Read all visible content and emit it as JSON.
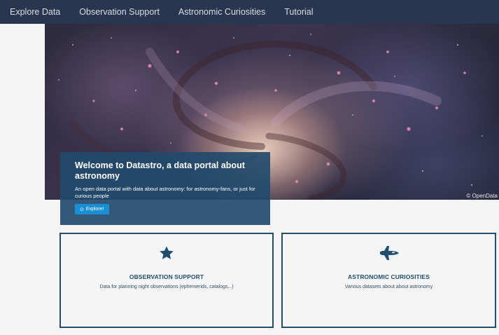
{
  "nav": {
    "items": [
      "Explore Data",
      "Observation Support",
      "Astronomic Curiosities",
      "Tutorial"
    ]
  },
  "hero": {
    "credit": "© OpenData"
  },
  "welcome": {
    "title": "Welcome to Datastro, a data portal about astronomy",
    "subtitle": "An open data portal with data about astronomy: for astronomy-fans, or just for curious people",
    "button_icon": "compass-icon",
    "button_label": "Explore!"
  },
  "cards": [
    {
      "icon": "star-icon",
      "title": "OBSERVATION SUPPORT",
      "description": "Data for planning night observations (ephemerids, catalogs...)"
    },
    {
      "icon": "space-shuttle-icon",
      "title": "ASTRONOMIC CURIOSITIES",
      "description": "Various datasets about about astronomy"
    }
  ],
  "colors": {
    "navbar": "#28364f",
    "welcome_panel": "#234a6b",
    "button": "#1a8fd6",
    "card_border": "#1f4e6e",
    "background": "#f5f5f5"
  }
}
